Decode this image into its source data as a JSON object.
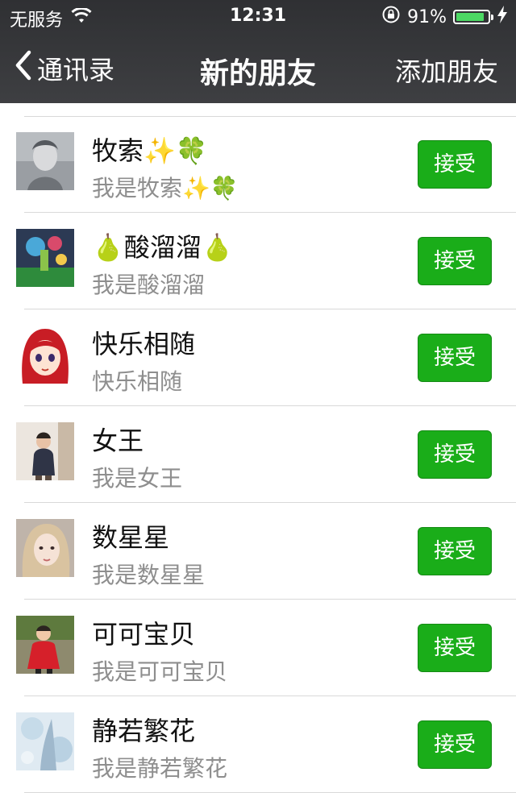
{
  "status_bar": {
    "carrier": "无服务",
    "time": "12:31",
    "battery": "91%",
    "battery_level": 0.91
  },
  "nav": {
    "back_label": "通讯录",
    "title": "新的朋友",
    "action_label": "添加朋友"
  },
  "requests": [
    {
      "name": "牧索✨🍀",
      "message": "我是牧索✨🍀",
      "button": "接受"
    },
    {
      "name": "🍐酸溜溜🍐",
      "message": "我是酸溜溜",
      "button": "接受"
    },
    {
      "name": "快乐相随",
      "message": "快乐相随",
      "button": "接受"
    },
    {
      "name": "女王",
      "message": "我是女王",
      "button": "接受"
    },
    {
      "name": "数星星",
      "message": "我是数星星",
      "button": "接受"
    },
    {
      "name": "可可宝贝",
      "message": "我是可可宝贝",
      "button": "接受"
    },
    {
      "name": "静若繁花",
      "message": "我是静若繁花",
      "button": "接受"
    }
  ],
  "colors": {
    "accent": "#1aad19",
    "nav_background": "#38393c",
    "battery_fill": "#4cd964"
  }
}
